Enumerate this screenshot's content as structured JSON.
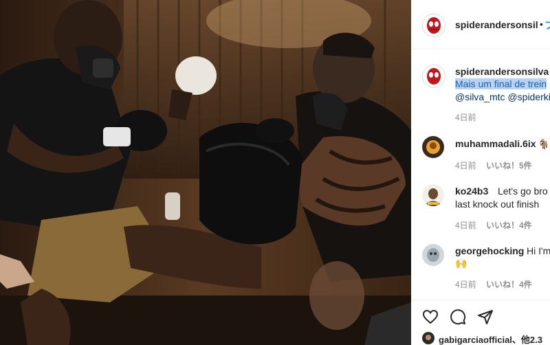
{
  "header": {
    "username": "spiderandersonsil",
    "separator": "•",
    "follow": "フ"
  },
  "caption": {
    "username": "spiderandersonsilva",
    "line1": "Mais um final de trein",
    "line2": "@silva_mtc @spiderki",
    "time": "4日前"
  },
  "comments": [
    {
      "username": "muhammadali.6ix",
      "text": "🐐",
      "line2": "",
      "time": "4日前",
      "likes": "いいね！5件"
    },
    {
      "username": "ko24b3",
      "text": "Let's go bro g",
      "line2": "last knock out finish",
      "time": "4日前",
      "likes": "いいね！4件"
    },
    {
      "username": "georgehocking",
      "text": "Hi I'm",
      "line2": "🙌",
      "time": "4日前",
      "likes": "いいね！4件"
    }
  ],
  "footer": {
    "liked_by": "gabigarciaofficial、他2.3",
    "partial": "ぱ"
  },
  "icons": {
    "like": "heart-icon",
    "comment": "comment-icon",
    "share": "send-icon"
  },
  "colors": {
    "link": "#00376b",
    "follow": "#0095f6",
    "highlight": "#b7d3f4"
  }
}
